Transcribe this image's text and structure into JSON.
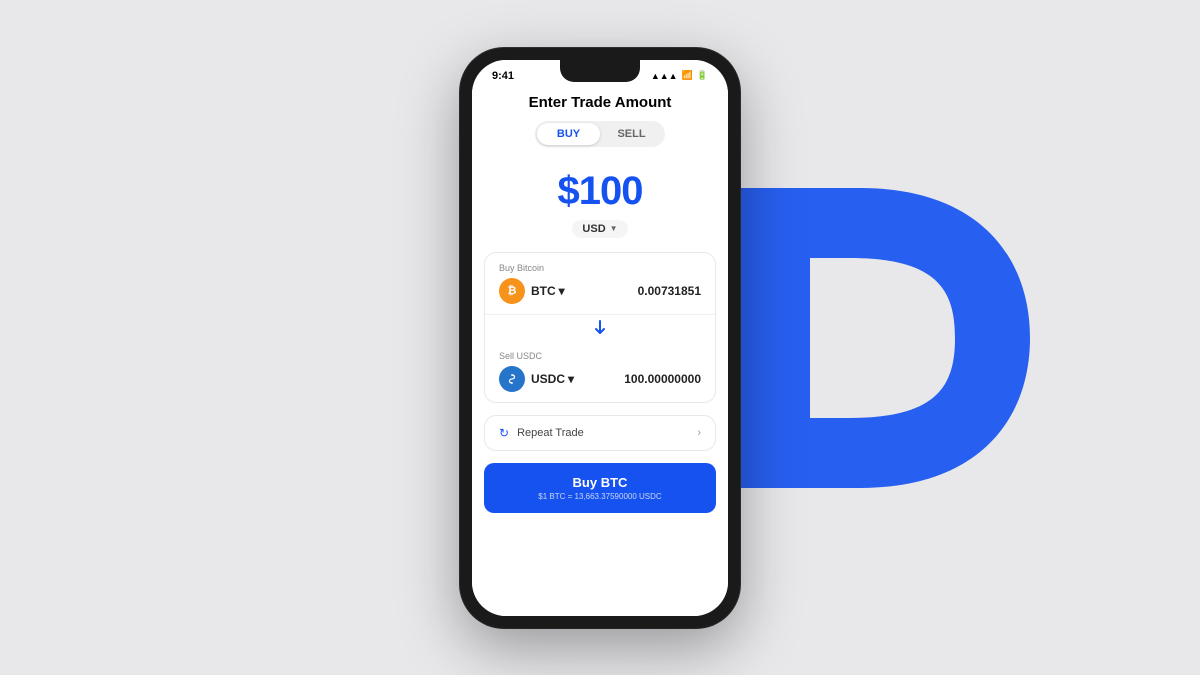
{
  "background": {
    "color": "#e8e8eb"
  },
  "status_bar": {
    "time": "9:41",
    "signal": "▲▲▲",
    "wifi": "WiFi",
    "battery": "●"
  },
  "screen": {
    "title": "Enter Trade Amount",
    "toggle": {
      "buy_label": "BUY",
      "sell_label": "SELL",
      "active": "buy"
    },
    "amount": {
      "value": "$100",
      "currency": "USD"
    },
    "trade_details": {
      "buy_label": "Buy Bitcoin",
      "buy_asset": "BTC",
      "buy_amount": "0.00731851",
      "sell_label": "Sell USDC",
      "sell_asset": "USDC",
      "sell_amount": "100.00000000"
    },
    "repeat_trade": {
      "label": "Repeat Trade",
      "icon": "↻"
    },
    "buy_button": {
      "main_label": "Buy BTC",
      "sub_label": "$1 BTC = 13,663.37590000 USDC"
    }
  }
}
